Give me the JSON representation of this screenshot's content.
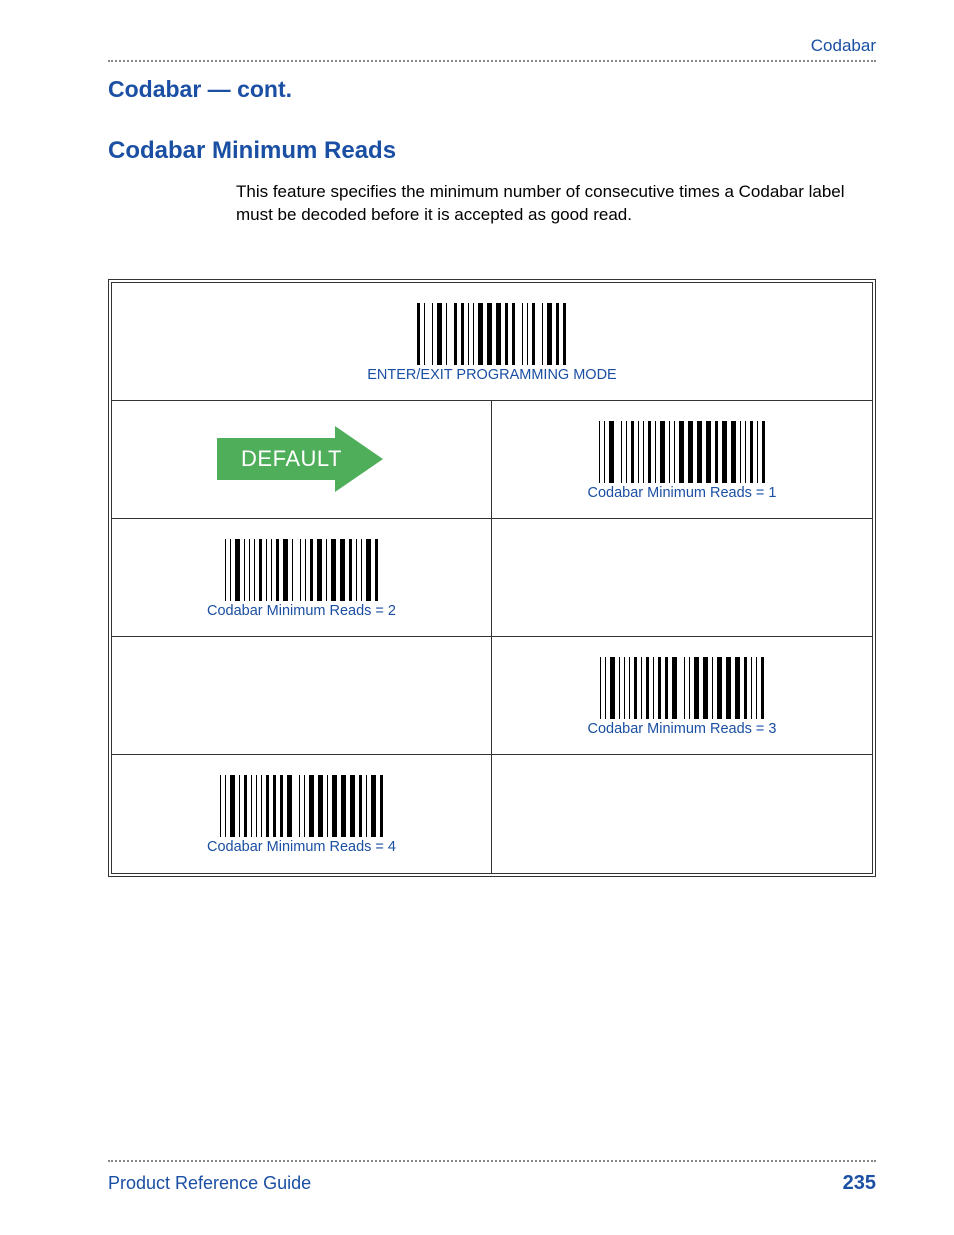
{
  "header": {
    "running_head": "Codabar"
  },
  "section": {
    "title": "Codabar — cont.",
    "subtitle": "Codabar Minimum Reads",
    "body": "This feature specifies the minimum number of consecutive times a Codabar label must be decoded before it is accepted as good read."
  },
  "barcodes": {
    "enter_exit": "ENTER/EXIT PROGRAMMING MODE",
    "default_label": "DEFAULT",
    "reads1": "Codabar Minimum Reads = 1",
    "reads2": "Codabar Minimum Reads = 2",
    "reads3": "Codabar Minimum Reads = 3",
    "reads4": "Codabar Minimum Reads = 4"
  },
  "footer": {
    "title": "Product Reference Guide",
    "page": "235"
  }
}
